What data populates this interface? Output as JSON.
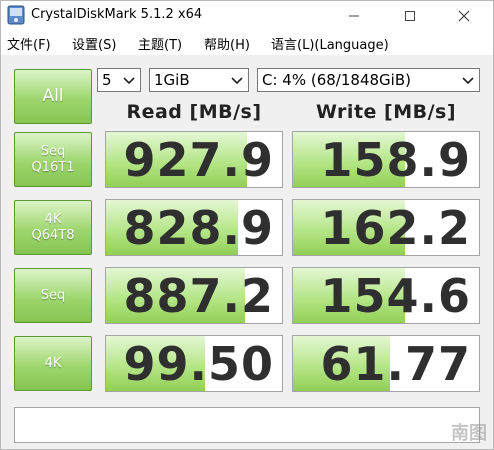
{
  "window": {
    "title": "CrystalDiskMark 5.1.2 x64"
  },
  "menu": [
    {
      "label": "文件(F)"
    },
    {
      "label": "设置(S)"
    },
    {
      "label": "主题(T)"
    },
    {
      "label": "帮助(H)"
    },
    {
      "label": "语言(L)(Language)"
    }
  ],
  "controls": {
    "all_label": "All",
    "count": "5",
    "size": "1GiB",
    "drive": "C: 4% (68/1848GiB)"
  },
  "headers": {
    "read": "Read [MB/s]",
    "write": "Write [MB/s]"
  },
  "tests": [
    {
      "label": "Seq\nQ16T1",
      "read": "927.9",
      "write": "158.9",
      "read_fill": 0.8,
      "write_fill": 0.6
    },
    {
      "label": "4K\nQ64T8",
      "read": "828.9",
      "write": "162.2",
      "read_fill": 0.75,
      "write_fill": 0.6
    },
    {
      "label": "Seq",
      "read": "887.2",
      "write": "154.6",
      "read_fill": 0.79,
      "write_fill": 0.6
    },
    {
      "label": "4K",
      "read": "99.50",
      "write": "61.77",
      "read_fill": 0.56,
      "write_fill": 0.52
    }
  ],
  "comment": "",
  "watermark": "南图",
  "colors": {
    "accent_green": "#86c452",
    "bar_green": "#b5e688"
  },
  "icons": {
    "app": "disk-icon",
    "minimize": "minimize-icon",
    "maximize": "maximize-icon",
    "close": "close-icon",
    "dropdown": "chevron-down-icon"
  }
}
